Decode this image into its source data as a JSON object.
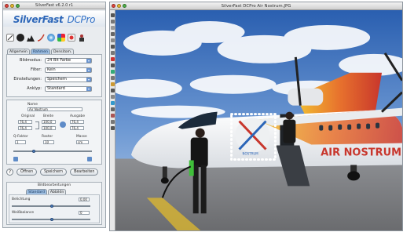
{
  "control_window": {
    "title": "SilverFast v6.2.0 r1",
    "brand_silver": "SilverFast",
    "brand_pro": "DCPro",
    "tabs": [
      "Allgemein",
      "Rahmen",
      "Densitom."
    ],
    "rows": [
      {
        "label": "Bildmodus:",
        "value": "24 Bit Farbe"
      },
      {
        "label": "Filter:",
        "value": "Kein"
      },
      {
        "label": "Einstellungen:",
        "value": "Speichern"
      },
      {
        "label": "Anklyp:",
        "value": "Standard"
      }
    ],
    "frame": {
      "name_label": "Name",
      "name_value": "Air Nostrum",
      "original": "Original",
      "breite": "Breite",
      "ausgabe": "Ausgabe",
      "fields_left": [
        "76,4",
        "76,4"
      ],
      "fields_mid": [
        "100,0",
        "100,0"
      ],
      "fields_right": [
        "76,4",
        "76,4"
      ],
      "q_faktor": "Q-Faktor",
      "raster": "Raster",
      "masse": "Masse",
      "q_value": "1",
      "raster_value": "10",
      "masse_value": "cm"
    },
    "buttons": {
      "help": "?",
      "open": "Öffnen",
      "save": "Speichern",
      "process": "Bearbeiten",
      "close": "×"
    },
    "lower": {
      "header": "Bildbearbeitungen",
      "tabs": [
        "Standard",
        "Abbildn"
      ],
      "slider1_label": "Belichtung",
      "slider1_value": "0,00",
      "slider2_label": "Weißbalance",
      "slider2_value": "0"
    }
  },
  "image_window": {
    "title": "SilverFast DCPro Air Nostrum.JPG",
    "livery_word": "AIR NOSTRUM",
    "logo_text": "NOSTRUM"
  },
  "colors": {
    "accent_blue": "#2c66b8",
    "tab_active": "#9dbde0",
    "sky_top": "#2f66b5",
    "livery_red": "#c8362c"
  }
}
